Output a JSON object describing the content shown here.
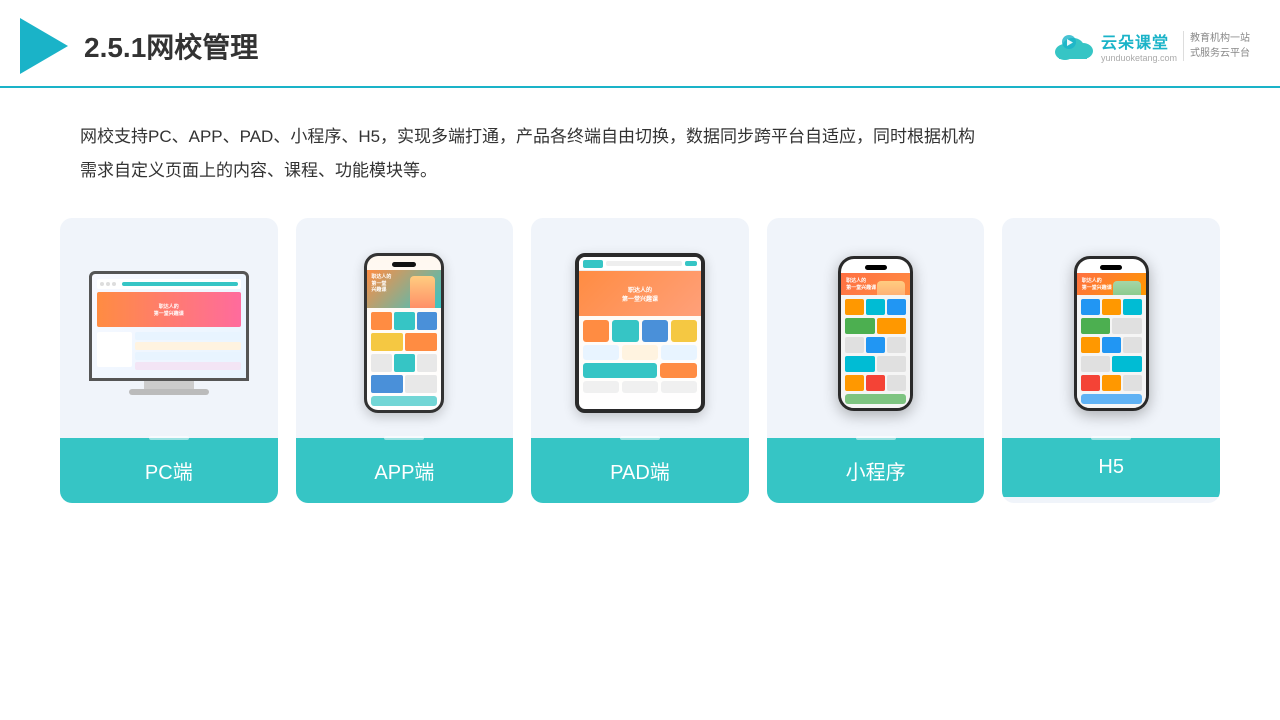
{
  "header": {
    "section_num": "2.5.1",
    "title": "网校管理",
    "brand_name": "云朵课堂",
    "brand_url": "yunduoketang.com",
    "brand_slogan_1": "教育机构一站",
    "brand_slogan_2": "式服务云平台"
  },
  "description": {
    "text": "网校支持PC、APP、PAD、小程序、H5，实现多端打通，产品各终端自由切换，数据同步跨平台自适应，同时根据机构\n需求自定义页面上的内容、课程、功能模块等。"
  },
  "cards": [
    {
      "id": "pc",
      "label": "PC端",
      "type": "pc"
    },
    {
      "id": "app",
      "label": "APP端",
      "type": "phone"
    },
    {
      "id": "pad",
      "label": "PAD端",
      "type": "tablet"
    },
    {
      "id": "miniprogram",
      "label": "小程序",
      "type": "miniphone"
    },
    {
      "id": "h5",
      "label": "H5",
      "type": "miniphone2"
    }
  ]
}
